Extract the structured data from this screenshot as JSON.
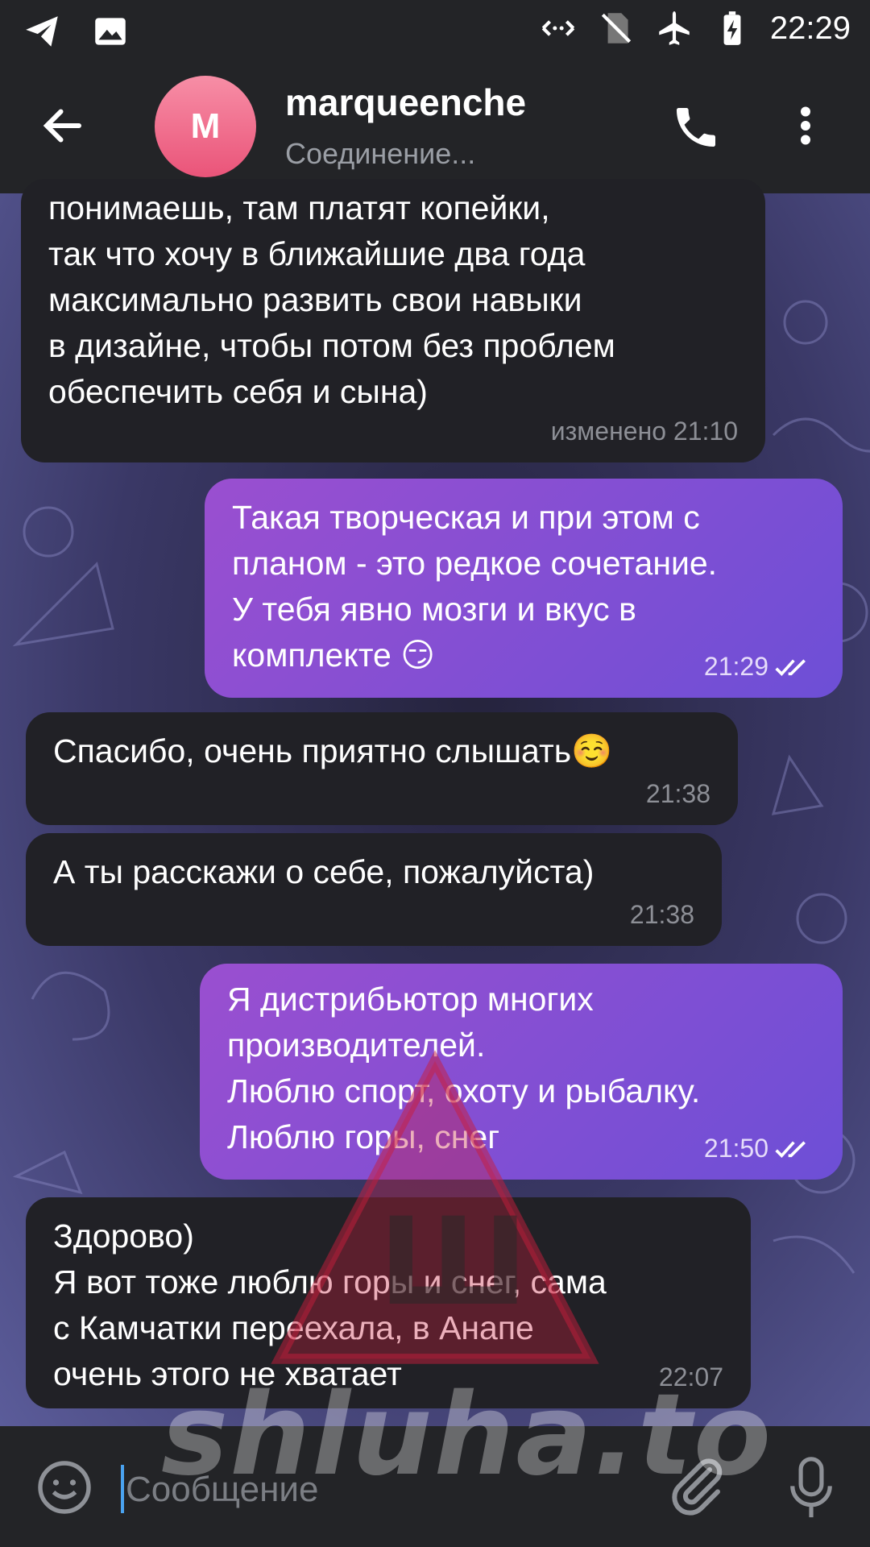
{
  "status_bar": {
    "time": "22:29"
  },
  "header": {
    "avatar_letter": "M",
    "contact_name": "marqueenche",
    "contact_status": "Соединение..."
  },
  "messages": [
    {
      "direction": "incoming",
      "text": "понимаешь, там платят копейки,\nтак что хочу в ближайшие два года\nмаксимально развить свои навыки\nв дизайне, чтобы потом без проблем\nобеспечить себя и сына)",
      "meta": "изменено 21:10"
    },
    {
      "direction": "outgoing",
      "text": "Такая творческая и при этом с\nпланом - это редкое сочетание.\nУ тебя явно мозги и вкус в\nкомплекте 😏",
      "meta": "21:29"
    },
    {
      "direction": "incoming",
      "text": "Спасибо, очень приятно слышать☺️",
      "meta": "21:38"
    },
    {
      "direction": "incoming",
      "text": "А ты расскажи о себе, пожалуйста)",
      "meta": "21:38"
    },
    {
      "direction": "outgoing",
      "text": "Я дистрибьютор многих\nпроизводителей.\nЛюблю спорт, охоту и рыбалку.\nЛюблю горы, снег",
      "meta": "21:50"
    },
    {
      "direction": "incoming",
      "text": "Здорово)\nЯ вот тоже люблю горы и снег, сама\nс Камчатки переехала, в Анапе\nочень этого не хватает",
      "meta": "22:07"
    }
  ],
  "composer": {
    "placeholder": "Сообщение"
  },
  "watermark": {
    "text": "shluha.to",
    "letter": "Ш"
  },
  "colors": {
    "incoming_bubble": "#212126",
    "outgoing_bubble_start": "#9a4fd0",
    "outgoing_bubble_end": "#6d4fd6",
    "avatar": "#ea5479"
  }
}
